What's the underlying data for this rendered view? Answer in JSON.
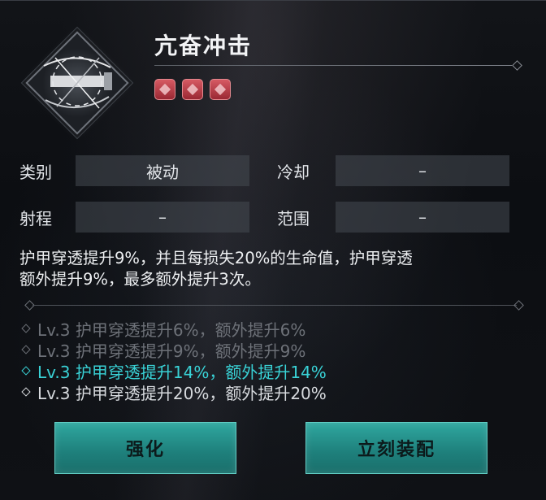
{
  "skill": {
    "name": "亢奋冲击",
    "icon": "sword-slash-icon",
    "gems": [
      "gem-icon",
      "gem-icon",
      "gem-icon"
    ]
  },
  "stats": {
    "category_label": "类别",
    "category_value": "被动",
    "cooldown_label": "冷却",
    "cooldown_value": "–",
    "range_label": "射程",
    "range_value": "–",
    "area_label": "范围",
    "area_value": "–"
  },
  "description": {
    "line1": "护甲穿透提升9%，并且每损失20%的生命值，护甲穿透",
    "line2": "额外提升9%，最多额外提升3次。"
  },
  "levels": [
    {
      "text": "Lv.3 护甲穿透提升6%，额外提升6%"
    },
    {
      "text": "Lv.3 护甲穿透提升9%，额外提升9%"
    },
    {
      "text": "Lv.3 护甲穿透提升14%，额外提升14%"
    },
    {
      "text": "Lv.3 护甲穿透提升20%，额外提升20%"
    }
  ],
  "buttons": {
    "upgrade": "强化",
    "equip": "立刻装配"
  },
  "colors": {
    "accent_teal": "#39d2d6",
    "button_teal": "#2fa79f",
    "gem_red": "#c84450"
  }
}
